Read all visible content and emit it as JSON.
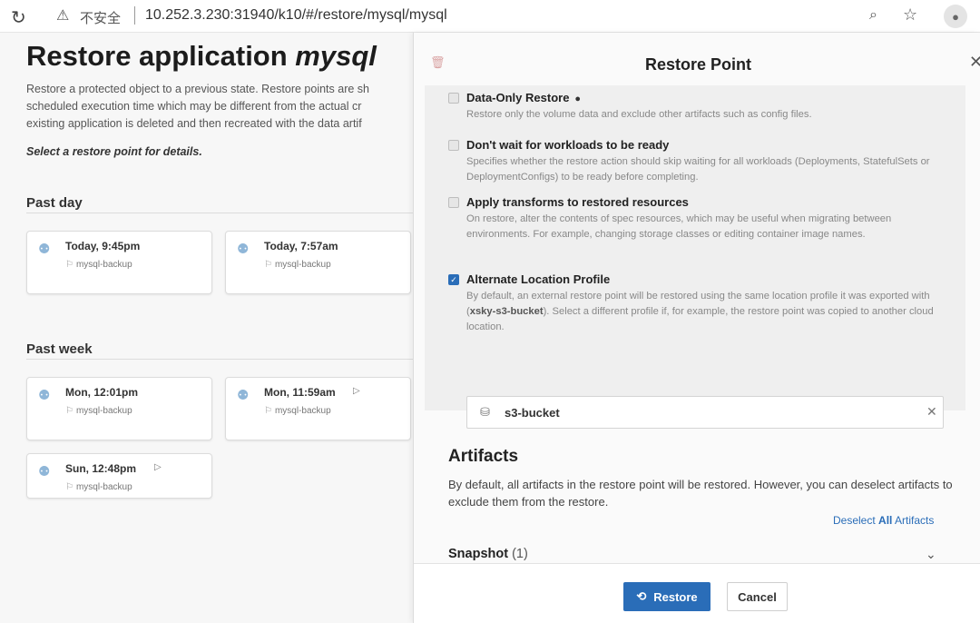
{
  "browser": {
    "reload_icon": "reload-icon",
    "warning_label": "不安全",
    "url": "10.252.3.230:31940/k10/#/restore/mysql/mysql"
  },
  "page": {
    "title_prefix": "Restore application ",
    "title_app": "mysql",
    "description_lines": [
      "Restore a protected object to a previous state. Restore points are sh",
      "scheduled execution time which may be different from the actual cr",
      "existing application is deleted and then recreated with the data artif"
    ],
    "select_hint": "Select a restore point for details.",
    "sections": [
      {
        "title": "Past day",
        "points": [
          {
            "time": "Today, 9:45pm",
            "policy": "mysql-backup",
            "exported": false
          },
          {
            "time": "Today, 7:57am",
            "policy": "mysql-backup",
            "exported": false
          }
        ]
      },
      {
        "title": "Past week",
        "points": [
          {
            "time": "Mon, 12:01pm",
            "policy": "mysql-backup",
            "exported": false
          },
          {
            "time": "Mon, 11:59am",
            "policy": "mysql-backup",
            "exported": true
          },
          {
            "time": "Sun, 12:48pm",
            "policy": "mysql-backup",
            "exported": true
          }
        ]
      }
    ]
  },
  "panel": {
    "title": "Restore Point",
    "options": [
      {
        "title": "Data-Only Restore",
        "checked": false,
        "desc": "Restore only the volume data and exclude other artifacts such as config files."
      },
      {
        "title": "Don't wait for workloads to be ready",
        "checked": false,
        "desc": "Specifies whether the restore action should skip waiting for all workloads (Deployments, StatefulSets or DeploymentConfigs) to be ready before completing."
      },
      {
        "title": "Apply transforms to restored resources",
        "checked": false,
        "desc": "On restore, alter the contents of spec resources, which may be useful when migrating between environments. For example, changing storage classes or editing container image names."
      },
      {
        "title": "Alternate Location Profile",
        "checked": true,
        "desc_pre": "By default, an external restore point will be restored using the same location profile it was exported with (",
        "desc_bold": "xsky-s3-bucket",
        "desc_post": "). Select a different profile if, for example, the restore point was copied to another cloud location."
      }
    ],
    "profile_value": "s3-bucket",
    "artifacts_title": "Artifacts",
    "artifacts_desc": "By default, all artifacts in the restore point will be restored. However, you can deselect artifacts to exclude them from the restore.",
    "deselect_pre": "Deselect ",
    "deselect_all": "All",
    "deselect_post": " Artifacts",
    "snapshot_label": "Snapshot",
    "snapshot_count": "(1)",
    "restore_label": "Restore",
    "cancel_label": "Cancel"
  },
  "colors": {
    "accent": "#2a6db8",
    "pin": "#8fb6d8"
  }
}
